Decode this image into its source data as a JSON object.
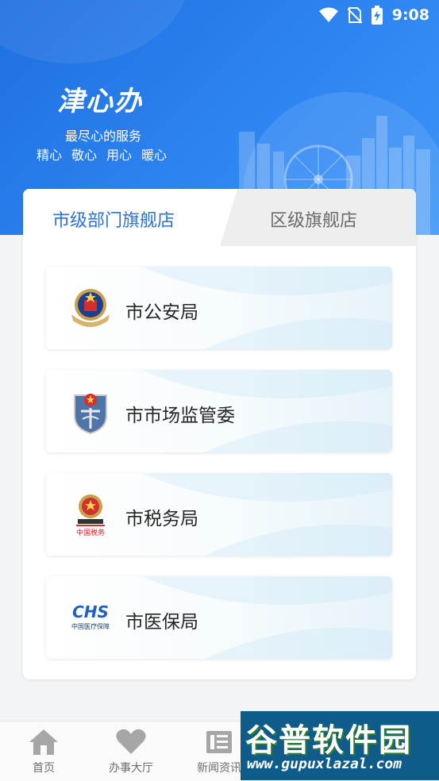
{
  "status_bar": {
    "time": "9:08",
    "icons": [
      "wifi-icon",
      "no-sim-icon",
      "battery-charging-icon"
    ]
  },
  "header": {
    "logo": "津心办",
    "slogan": "最尽心的服务",
    "values": [
      "精心",
      "敬心",
      "用心",
      "暖心"
    ]
  },
  "tabs": {
    "active": "市级部门旗舰店",
    "inactive": "区级旗舰店"
  },
  "departments": [
    {
      "name": "市公安局",
      "icon": "police-emblem-icon"
    },
    {
      "name": "市市场监管委",
      "icon": "market-supervision-emblem-icon"
    },
    {
      "name": "市税务局",
      "icon": "tax-emblem-icon"
    },
    {
      "name": "市医保局",
      "icon": "chs-logo-icon",
      "logo_text": "CHS",
      "logo_subtext": "中国医疗保障"
    }
  ],
  "bottom_nav": [
    {
      "label": "首页",
      "icon": "home-icon"
    },
    {
      "label": "办事大厅",
      "icon": "heart-icon"
    },
    {
      "label": "新闻资讯",
      "icon": "news-icon"
    }
  ],
  "watermark": {
    "title": "谷普软件园",
    "url": "www.gupuxlazal.com"
  },
  "colors": {
    "primary": "#2b72d9",
    "header_bg": "#2f86f2",
    "tab_inactive_bg": "#eeeeee"
  }
}
